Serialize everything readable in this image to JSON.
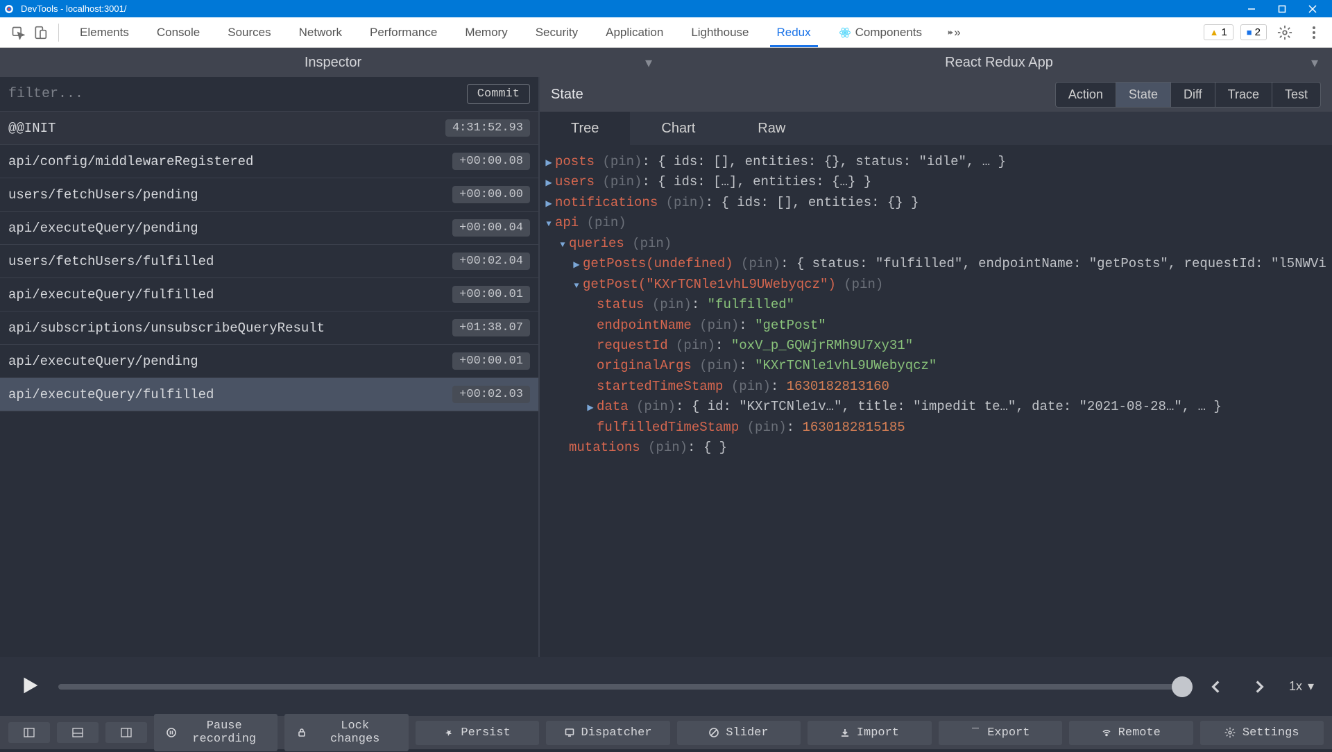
{
  "window": {
    "title": "DevTools - localhost:3001/"
  },
  "devtools": {
    "tabs": [
      "Elements",
      "Console",
      "Sources",
      "Network",
      "Performance",
      "Memory",
      "Security",
      "Application",
      "Lighthouse",
      "Redux",
      "Components"
    ],
    "active_tab": "Redux",
    "warn_count": "1",
    "info_count": "2"
  },
  "header": {
    "left": "Inspector",
    "right": "React Redux App"
  },
  "filter": {
    "placeholder": "filter...",
    "commit_label": "Commit"
  },
  "actions": [
    {
      "name": "@@INIT",
      "time": "4:31:52.93",
      "first": true
    },
    {
      "name": "api/config/middlewareRegistered",
      "time": "+00:00.08"
    },
    {
      "name": "users/fetchUsers/pending",
      "time": "+00:00.00"
    },
    {
      "name": "api/executeQuery/pending",
      "time": "+00:00.04"
    },
    {
      "name": "users/fetchUsers/fulfilled",
      "time": "+00:02.04"
    },
    {
      "name": "api/executeQuery/fulfilled",
      "time": "+00:00.01"
    },
    {
      "name": "api/subscriptions/unsubscribeQueryResult",
      "time": "+01:38.07"
    },
    {
      "name": "api/executeQuery/pending",
      "time": "+00:00.01"
    },
    {
      "name": "api/executeQuery/fulfilled",
      "time": "+00:02.03",
      "selected": true
    }
  ],
  "state_panel": {
    "title": "State",
    "views": [
      "Action",
      "State",
      "Diff",
      "Trace",
      "Test"
    ],
    "active_view": "State",
    "subtabs": [
      "Tree",
      "Chart",
      "Raw"
    ],
    "active_subtab": "Tree"
  },
  "tree": {
    "posts_summary": "{ ids: [], entities: {}, status: \"idle\", … }",
    "users_summary": "{ ids: […], entities: {…} }",
    "notifications_summary": "{ ids: [], entities: {} }",
    "getPosts_summary": "{ status: \"fulfilled\", endpointName: \"getPosts\", requestId: \"l5NWVi",
    "getPost_arg": "getPost(\"KXrTCNle1vhL9UWebyqcz\")",
    "status": "\"fulfilled\"",
    "endpointName": "\"getPost\"",
    "requestId": "\"oxV_p_GQWjrRMh9U7xy31\"",
    "originalArgs": "\"KXrTCNle1vhL9UWebyqcz\"",
    "startedTimeStamp": "1630182813160",
    "data_summary": "{ id: \"KXrTCNle1v…\", title: \"impedit te…\", date: \"2021-08-28…\", … }",
    "fulfilledTimeStamp": "1630182815185",
    "mutations_summary": "{ }"
  },
  "player": {
    "speed": "1x"
  },
  "bottom": {
    "pause": "Pause recording",
    "lock": "Lock changes",
    "persist": "Persist",
    "dispatcher": "Dispatcher",
    "slider": "Slider",
    "import": "Import",
    "export": "Export",
    "remote": "Remote",
    "settings": "Settings"
  }
}
